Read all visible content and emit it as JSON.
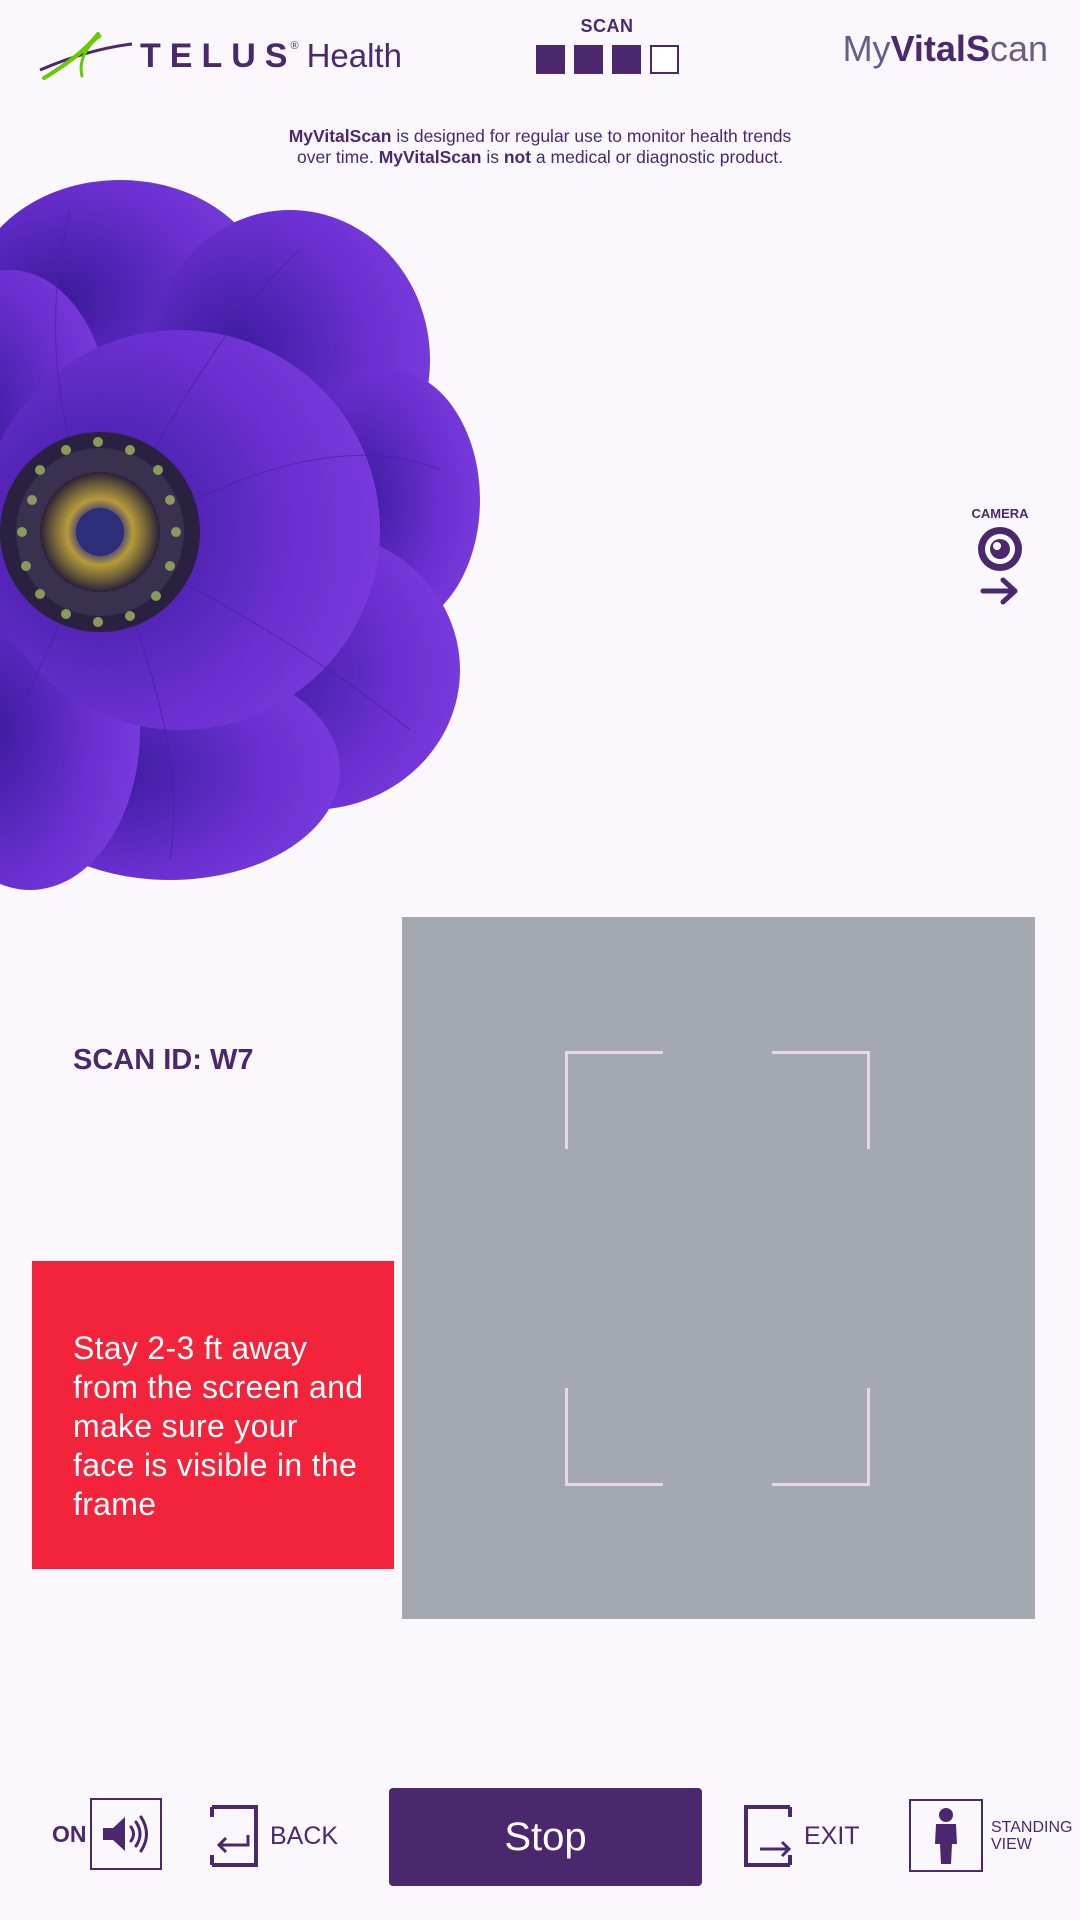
{
  "colors": {
    "brand_purple": "#4b286d",
    "brand_green": "#66cc00",
    "alert_red": "#f2233a",
    "camera_frame_gray": "#a3a8b1",
    "background": "#fbf8fd"
  },
  "header": {
    "brand_name": "TELUS",
    "brand_reg": "®",
    "brand_suffix": "Health",
    "progress": {
      "label": "SCAN",
      "filled_steps": 3,
      "total_steps": 4
    },
    "product_logo": {
      "part1": "My",
      "part2": "VitalS",
      "part3": "can"
    }
  },
  "disclaimer": {
    "l1_bold": "MyVitalScan",
    "l1_text": " is designed for regular use to monitor health trends",
    "l2_text": "over time. ",
    "l2_bold": "MyVitalScan",
    "l2_text2": " is ",
    "l2_bold2": "not",
    "l2_text3": " a medical or diagnostic product."
  },
  "camera_indicator": {
    "label": "CAMERA",
    "icon": "camera-eye-icon",
    "arrow": "arrow-right-icon"
  },
  "scan_id": "SCAN ID: W7",
  "instruction": "Stay 2-3 ft away from the screen and make sure your face is visible in the frame",
  "footer": {
    "sound_label": "ON",
    "sound_icon": "speaker-on-icon",
    "back_label": "BACK",
    "back_icon": "back-door-icon",
    "stop_label": "Stop",
    "exit_label": "EXIT",
    "exit_icon": "exit-door-icon",
    "standing_line1": "STANDING",
    "standing_line2": "VIEW",
    "standing_icon": "person-standing-icon"
  }
}
